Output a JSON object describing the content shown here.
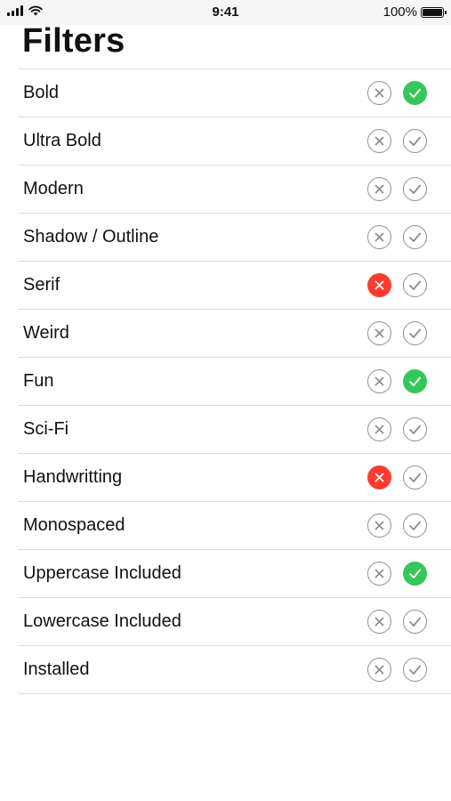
{
  "status_bar": {
    "time": "9:41",
    "battery": "100%"
  },
  "page": {
    "title": "Filters"
  },
  "colors": {
    "include_active": "#34c759",
    "exclude_active": "#ff3b30",
    "inactive": "#8e8e93"
  },
  "filters": [
    {
      "label": "Bold",
      "state": "include"
    },
    {
      "label": "Ultra Bold",
      "state": "none"
    },
    {
      "label": "Modern",
      "state": "none"
    },
    {
      "label": "Shadow / Outline",
      "state": "none"
    },
    {
      "label": "Serif",
      "state": "exclude"
    },
    {
      "label": "Weird",
      "state": "none"
    },
    {
      "label": "Fun",
      "state": "include"
    },
    {
      "label": "Sci-Fi",
      "state": "none"
    },
    {
      "label": "Handwritting",
      "state": "exclude"
    },
    {
      "label": "Monospaced",
      "state": "none"
    },
    {
      "label": "Uppercase Included",
      "state": "include"
    },
    {
      "label": "Lowercase Included",
      "state": "none"
    },
    {
      "label": "Installed",
      "state": "none"
    }
  ]
}
